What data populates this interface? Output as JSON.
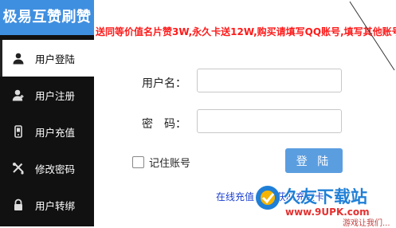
{
  "app": {
    "title": "极易互赞刷赞"
  },
  "sidebar": {
    "items": [
      {
        "label": "用户登陆",
        "icon": "user-icon"
      },
      {
        "label": "用户注册",
        "icon": "user-add-icon"
      },
      {
        "label": "用户充值",
        "icon": "wallet-icon"
      },
      {
        "label": "修改密码",
        "icon": "tools-icon"
      },
      {
        "label": "用户转绑",
        "icon": "lock-icon"
      }
    ]
  },
  "notice": {
    "text": "送同等价值名片赞3W,永久卡送12W,购买请填写QQ账号,填写其他账号"
  },
  "form": {
    "username_label": "用户名：",
    "password_label": "密　码：",
    "remember_label": "记住账号",
    "login_label": "登 陆",
    "recharge_link": "在线充值 免费获取充值卡"
  },
  "watermark": {
    "main": "久友下载站",
    "url": "www.9UPK.com",
    "sub": "游戏让我们..."
  },
  "colors": {
    "accent": "#3f8fe0",
    "notice": "#ff1a1a",
    "button": "#5b9ee0",
    "link": "#1a3fd0"
  }
}
